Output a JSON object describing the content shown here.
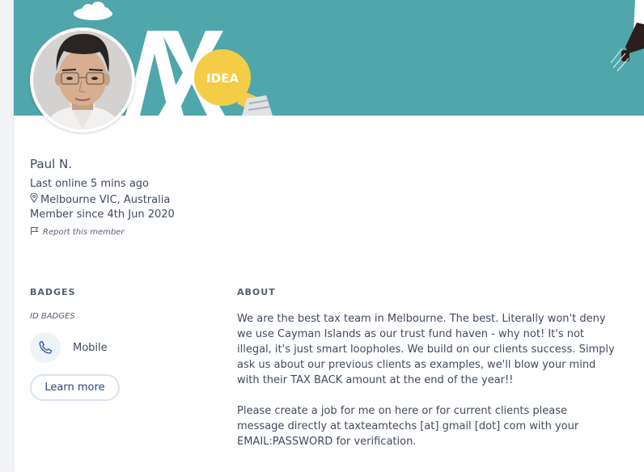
{
  "banner": {
    "idea_text": "IDEA",
    "bg_color": "#4fa7ac"
  },
  "profile": {
    "name": "Paul N.",
    "last_online": "Last online 5 mins ago",
    "location": "Melbourne VIC, Australia",
    "member_since": "Member since 4th Jun 2020",
    "report_label": "Report this member"
  },
  "badges": {
    "heading": "BADGES",
    "id_badges_label": "ID BADGES",
    "items": [
      {
        "label": "Mobile",
        "icon": "phone-icon"
      }
    ],
    "learn_more_label": "Learn more"
  },
  "about": {
    "heading": "ABOUT",
    "paragraphs": [
      "We are the best tax team in Melbourne. The best. Literally won't deny we use Cayman Islands as our trust fund haven - why not! It's not illegal, it's just smart loopholes. We build on our clients success. Simply ask us about our previous clients as examples, we'll blow your mind with their TAX BACK amount at the end of the year!!",
      "Please create a job for me on here or for current clients please message directly at taxteamtechs [at] gmail [dot] com with your EMAIL:PASSWORD for verification."
    ]
  }
}
